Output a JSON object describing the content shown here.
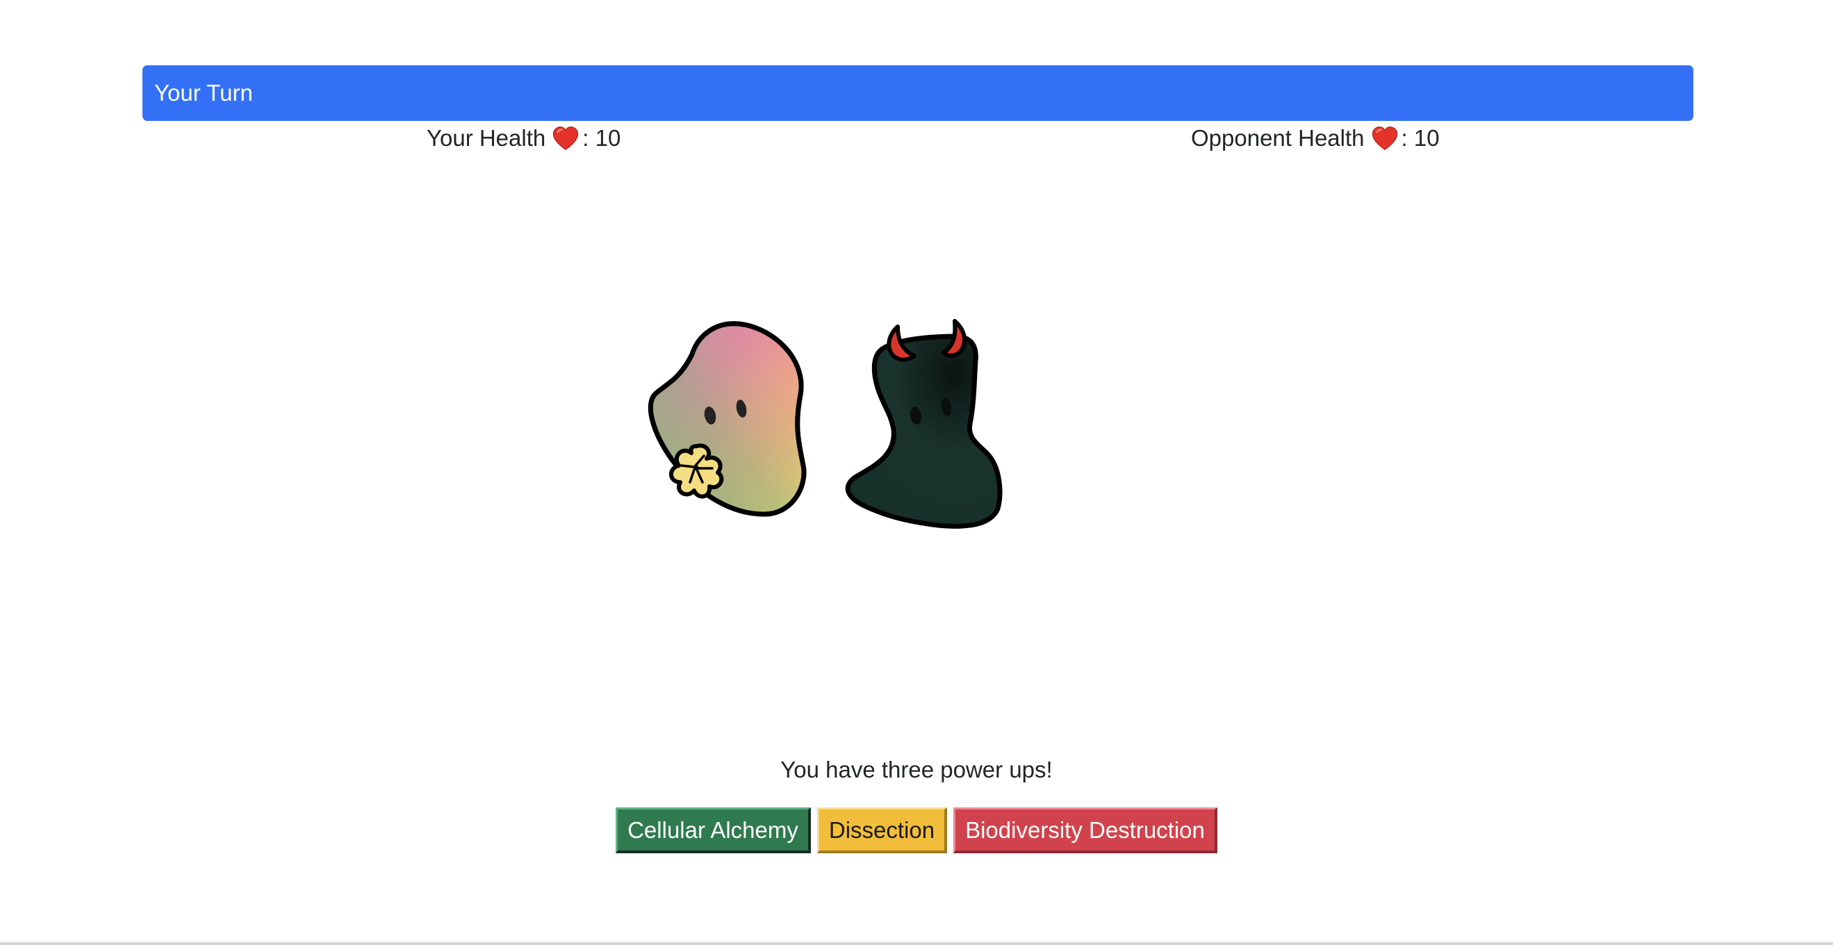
{
  "banner": {
    "turn_label": "Your Turn",
    "color": "#3370f5"
  },
  "health": {
    "player_label": "Your Health",
    "player_value": ": 10",
    "opponent_label": "Opponent Health",
    "opponent_value": ": 10",
    "icon": "heart-icon"
  },
  "arena": {
    "player_creature": "rainbow-blob-with-flower",
    "opponent_creature": "dark-green-blob-with-red-horns"
  },
  "powerups": {
    "message": "You have three power ups!",
    "buttons": [
      {
        "label": "Cellular Alchemy",
        "color": "#2f7a4e"
      },
      {
        "label": "Dissection",
        "color": "#f2bd3a"
      },
      {
        "label": "Biodiversity Destruction",
        "color": "#d0434c"
      }
    ]
  }
}
